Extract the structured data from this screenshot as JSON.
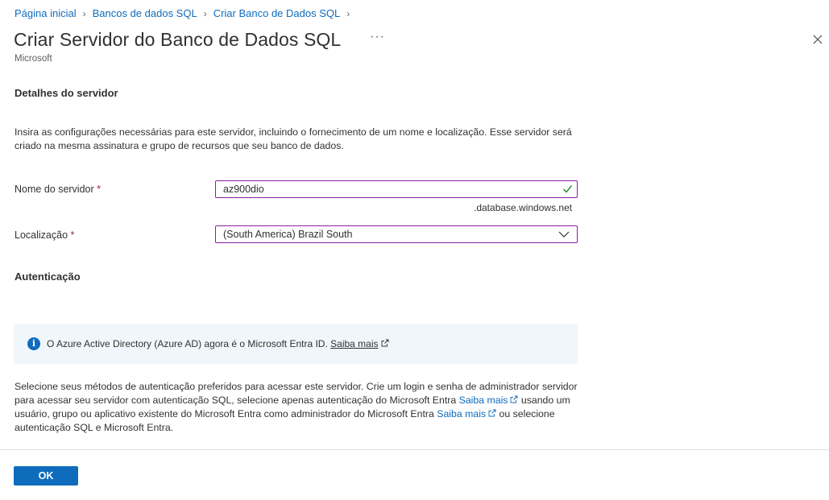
{
  "breadcrumb": [
    "Página inicial",
    "Bancos de dados SQL",
    "Criar Banco de Dados SQL"
  ],
  "header": {
    "title": "Criar Servidor do Banco de Dados SQL",
    "more_label": "···",
    "subtitle": "Microsoft"
  },
  "server_details": {
    "heading": "Detalhes do servidor",
    "description": "Insira as configurações necessárias para este servidor, incluindo o fornecimento de um nome e localização. Esse servidor será criado na mesma assinatura e grupo de recursos que seu banco de dados.",
    "server_name": {
      "label": "Nome do servidor",
      "required": "*",
      "value": "az900dio",
      "suffix": ".database.windows.net",
      "valid": true
    },
    "location": {
      "label": "Localização",
      "required": "*",
      "selected": "(South America) Brazil South"
    }
  },
  "authentication": {
    "heading": "Autenticação",
    "info_text": "O Azure Active Directory (Azure AD) agora é o Microsoft Entra ID.",
    "info_link": "Saiba mais",
    "desc_part1": "Selecione seus métodos de autenticação preferidos para acessar este servidor. Crie um login e senha de administrador servidor para acessar seu servidor com autenticação SQL, selecione apenas autenticação do Microsoft Entra",
    "link1": "Saiba mais",
    "desc_part2": "usando um usuário, grupo ou aplicativo existente do Microsoft Entra como administrador do Microsoft Entra",
    "link2": "Saiba mais",
    "desc_part3": "ou selecione autenticação SQL e Microsoft Entra."
  },
  "footer": {
    "ok_label": "OK"
  },
  "colors": {
    "link": "#0f6cbd",
    "field_border": "#8a1fa0",
    "valid_check": "#107c10",
    "info_bg": "#eff6fc",
    "required": "#a4262c"
  }
}
